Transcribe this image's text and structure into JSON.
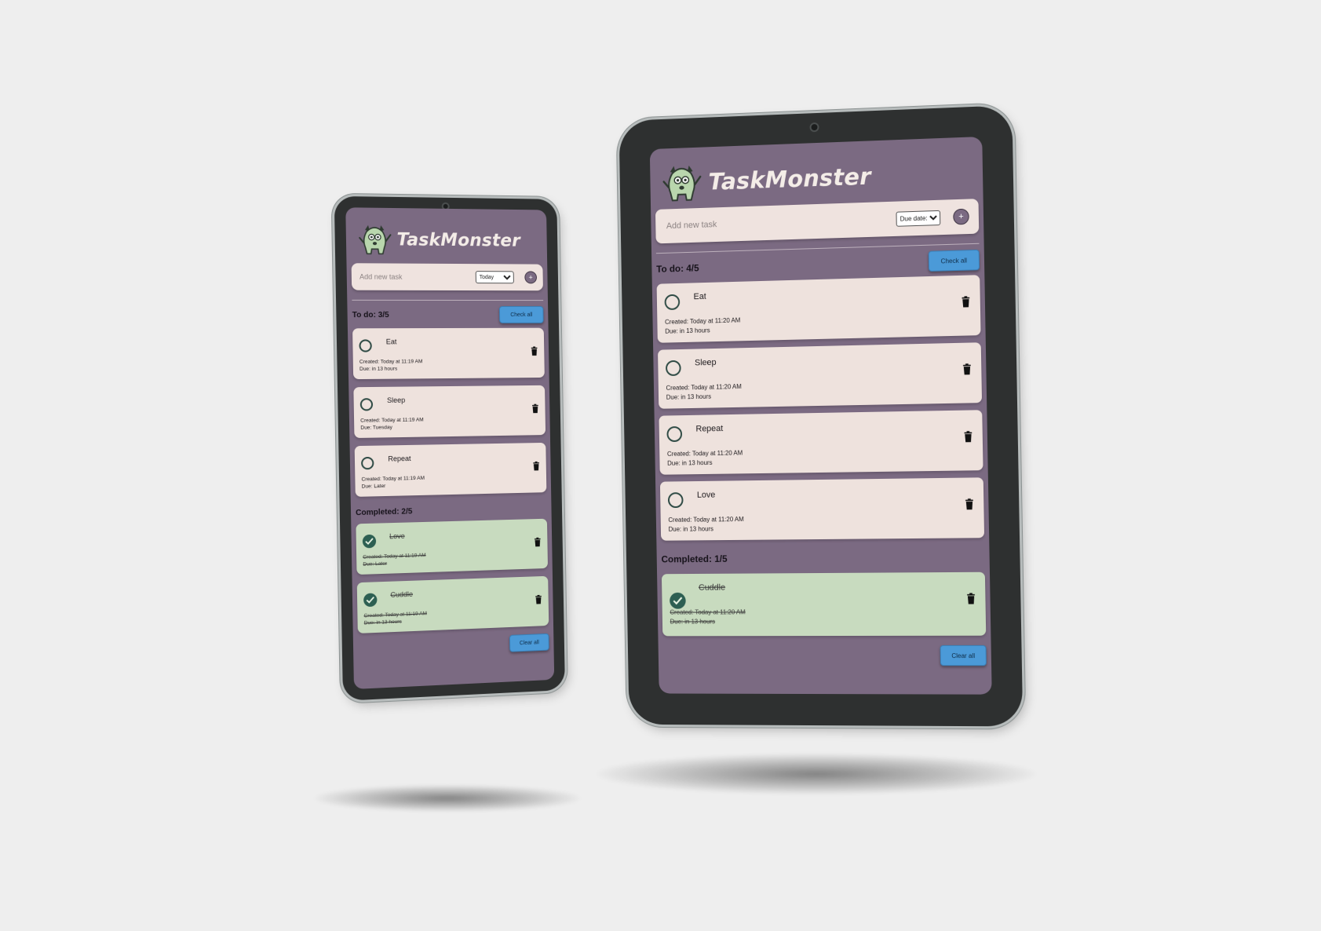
{
  "colors": {
    "background": "#eeeeee",
    "app_bg": "#7b6a82",
    "card": "#eee2dd",
    "card_done": "#c8dbbf",
    "accent_blue": "#4b9ad8",
    "check_green": "#2d5f52",
    "bezel": "#2e3030"
  },
  "icons": {
    "logo": "monster-logo-icon",
    "circle": "empty-circle-icon",
    "check": "checkmark-circle-icon",
    "trash": "trash-can-icon",
    "add": "plus-icon"
  },
  "phone": {
    "app_title": "TaskMonster",
    "add_placeholder": "Add new task",
    "due_selected": "Today",
    "add_button": "+",
    "todo_label": "To do: 3/5",
    "check_all": "Check all",
    "todo": [
      {
        "name": "Eat",
        "created": "Created: Today at 11:19 AM",
        "due": "Due: in 13 hours"
      },
      {
        "name": "Sleep",
        "created": "Created: Today at 11:19 AM",
        "due": "Due: Tuesday"
      },
      {
        "name": "Repeat",
        "created": "Created: Today at 11:19 AM",
        "due": "Due: Later"
      }
    ],
    "completed_label": "Completed: 2/5",
    "completed": [
      {
        "name": "Love",
        "created": "Created: Today at 11:19 AM",
        "due": "Due: Later"
      },
      {
        "name": "Cuddle",
        "created": "Created: Today at 11:19 AM",
        "due": "Due: in 13 hours"
      }
    ],
    "clear_all": "Clear all"
  },
  "tablet": {
    "app_title": "TaskMonster",
    "add_placeholder": "Add new task",
    "due_selected": "Due date:",
    "add_button": "+",
    "todo_label": "To do: 4/5",
    "check_all": "Check all",
    "todo": [
      {
        "name": "Eat",
        "created": "Created: Today at 11:20 AM",
        "due": "Due: in 13 hours"
      },
      {
        "name": "Sleep",
        "created": "Created: Today at 11:20 AM",
        "due": "Due: in 13 hours"
      },
      {
        "name": "Repeat",
        "created": "Created: Today at 11:20 AM",
        "due": "Due: in 13 hours"
      },
      {
        "name": "Love",
        "created": "Created: Today at 11:20 AM",
        "due": "Due: in 13 hours"
      }
    ],
    "completed_label": "Completed: 1/5",
    "completed": [
      {
        "name": "Cuddle",
        "created": "Created: Today at 11:20 AM",
        "due": "Due: in 13 hours"
      }
    ],
    "clear_all": "Clear all"
  }
}
